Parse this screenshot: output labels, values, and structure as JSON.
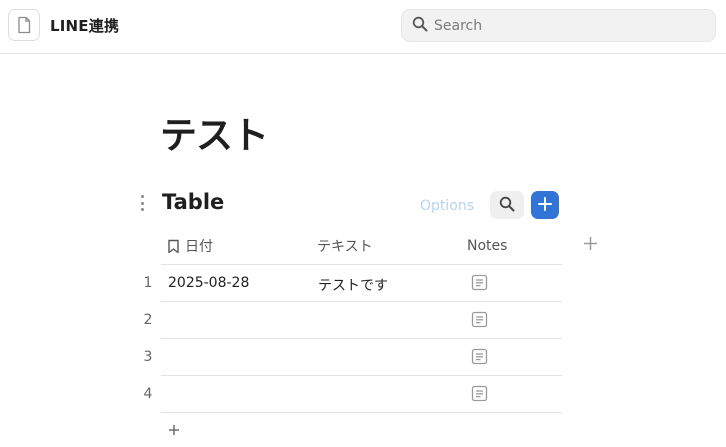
{
  "header": {
    "title": "LINE連携",
    "doc_icon": "document-icon",
    "search": {
      "placeholder": "Search",
      "value": ""
    }
  },
  "page": {
    "title": "テスト"
  },
  "table": {
    "title": "Table",
    "options_label": "Options",
    "columns": [
      {
        "label": "日付",
        "icon": "bookmark-icon"
      },
      {
        "label": "テキスト"
      },
      {
        "label": "Notes"
      }
    ],
    "rows": [
      {
        "num": "1",
        "date": "2025-08-28",
        "text": "テストです"
      },
      {
        "num": "2",
        "date": "",
        "text": ""
      },
      {
        "num": "3",
        "date": "",
        "text": ""
      },
      {
        "num": "4",
        "date": "",
        "text": ""
      }
    ]
  },
  "colors": {
    "accent": "#2f74d6",
    "options_text": "#b9d2ee"
  }
}
